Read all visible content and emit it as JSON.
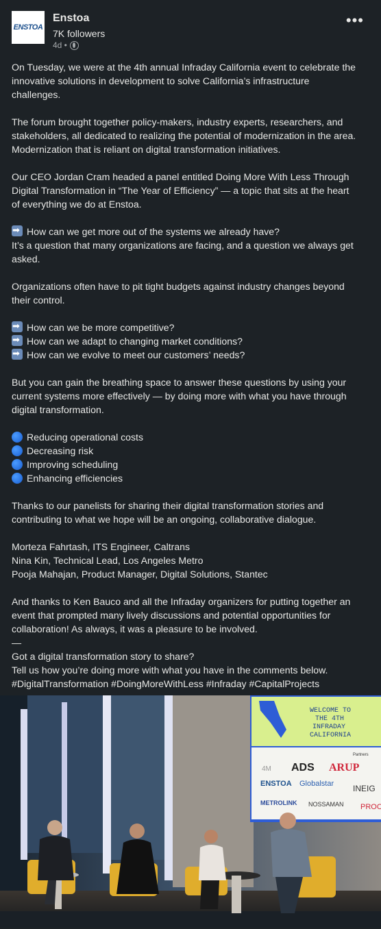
{
  "company": {
    "name": "Enstoa",
    "logo_text": "ENSTOA",
    "followers": "7K followers",
    "time": "4d •"
  },
  "post": {
    "paragraphs": [
      [
        "On Tuesday, we were at the 4th annual Infraday California event to celebrate the",
        "innovative solutions in development to solve California’s infrastructure",
        "challenges."
      ],
      [
        "The forum brought together policy-makers, industry experts, researchers, and",
        "stakeholders, all dedicated to realizing the potential of modernization in the area.",
        "Modernization that is reliant on digital transformation initiatives."
      ],
      [
        "Our CEO Jordan Cram headed a panel entitled Doing More With Less Through",
        "Digital Transformation in “The Year of Efficiency” — a topic that sits at the heart",
        "of everything we do at Enstoa."
      ]
    ],
    "q1": "How can we get more out of the systems we already have?",
    "q1_follow": [
      "It’s a question that many organizations are facing, and a question we always get",
      "asked."
    ],
    "budgets": [
      "Organizations often have to pit tight budgets against industry changes beyond",
      "their control."
    ],
    "questions": [
      "How can we be more competitive?",
      "How can we adapt to changing market conditions?",
      "How can we evolve to meet our customers’ needs?"
    ],
    "breathing": [
      "But you can gain the breathing space to answer these questions by using your",
      "current systems more effectively — by doing more with what you have through",
      "digital transformation."
    ],
    "bullets": [
      "Reducing operational costs",
      "Decreasing risk",
      "Improving scheduling",
      "Enhancing efficiencies"
    ],
    "thanks": [
      "Thanks to our panelists for sharing their digital transformation stories and",
      "contributing to what we hope will be an ongoing, collaborative dialogue."
    ],
    "panelists": [
      "Morteza Fahrtash, ITS Engineer, Caltrans",
      "Nina Kin, Technical Lead, Los Angeles Metro",
      "Pooja Mahajan, Product Manager, Digital Solutions, Stantec"
    ],
    "closing": [
      "And thanks to Ken Bauco and all the Infraday organizers for putting together an",
      "event that prompted many lively discussions and potential opportunities for",
      "collaboration! As always, it was a pleasure to be involved."
    ],
    "dash": "—",
    "cta": [
      "Got a digital transformation story to share?",
      "Tell us how you’re doing more with what you have in the comments below."
    ],
    "hashtags": "#DigitalTransformation #DoingMoreWithLess #Infraday #CapitalProjects"
  },
  "photo": {
    "screen_lines": [
      "WELCOME TO",
      "THE 4TH",
      "INFRADAY",
      "CALIFORNIA"
    ],
    "partners_label": "Partners",
    "sponsors": [
      "4M",
      "ADS",
      "ARUP",
      "ENSTOA",
      "Globalstar",
      "INEIG",
      "METROLINK",
      "NOSSAMAN",
      "PROC"
    ]
  },
  "colors": {
    "background": "#1d2226",
    "text": "#e8e8e6",
    "muted": "#a5a8ab",
    "screen_green": "#d9ef8e",
    "screen_blue": "#2e5dd6"
  }
}
